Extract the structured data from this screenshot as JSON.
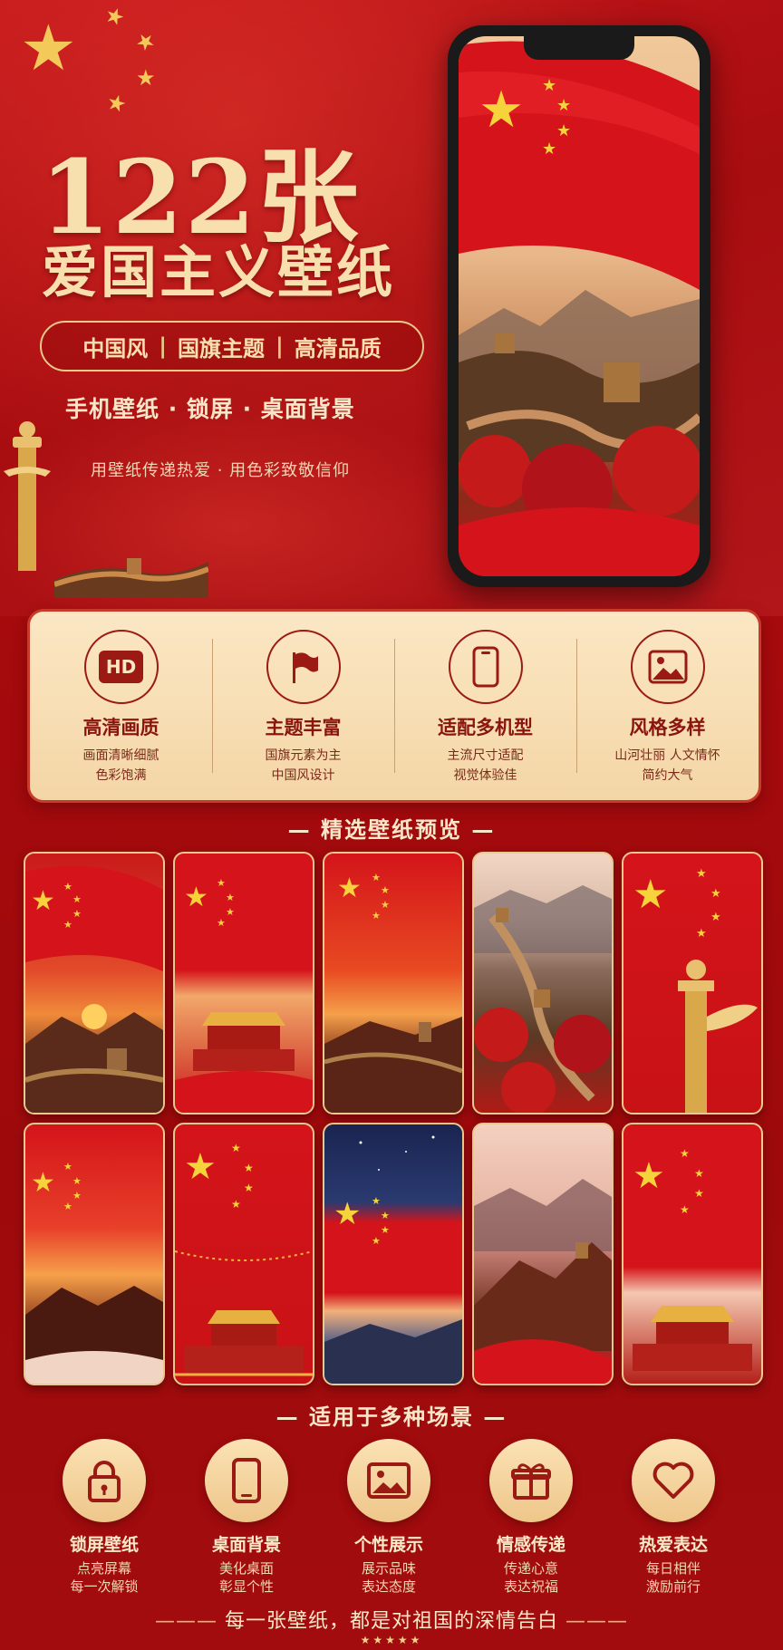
{
  "hero": {
    "title_number": "122张",
    "title_text": "爱国主义壁纸",
    "tags": [
      "中国风",
      "国旗主题",
      "高清品质"
    ],
    "tag_separator": "|",
    "usage_line": "手机壁纸 · 锁屏 · 桌面背景",
    "slogan": "用壁纸传递热爱 · 用色彩致敬信仰"
  },
  "features": [
    {
      "icon": "hd-icon",
      "badge": "HD",
      "title": "高清画质",
      "desc1": "画面清晰细腻",
      "desc2": "色彩饱满"
    },
    {
      "icon": "flag-icon",
      "badge": "",
      "title": "主题丰富",
      "desc1": "国旗元素为主",
      "desc2": "中国风设计"
    },
    {
      "icon": "phone-icon",
      "badge": "",
      "title": "适配多机型",
      "desc1": "主流尺寸适配",
      "desc2": "视觉体验佳"
    },
    {
      "icon": "image-icon",
      "badge": "",
      "title": "风格多样",
      "desc1": "山河壮丽 人文情怀",
      "desc2": "简约大气"
    }
  ],
  "preview_title": "— 精选壁纸预览 —",
  "scenes_title": "— 适用于多种场景 —",
  "scenes": [
    {
      "icon": "lock-icon",
      "title": "锁屏壁纸",
      "desc1": "点亮屏幕",
      "desc2": "每一次解锁"
    },
    {
      "icon": "phone-icon",
      "title": "桌面背景",
      "desc1": "美化桌面",
      "desc2": "彰显个性"
    },
    {
      "icon": "image-icon",
      "title": "个性展示",
      "desc1": "展示品味",
      "desc2": "表达态度"
    },
    {
      "icon": "gift-icon",
      "title": "情感传递",
      "desc1": "传递心意",
      "desc2": "表达祝福"
    },
    {
      "icon": "heart-icon",
      "title": "热爱表达",
      "desc1": "每日相伴",
      "desc2": "激励前行"
    }
  ],
  "footer": {
    "text": "每一张壁纸，都是对祖国的深情告白",
    "stars": "★★★★★"
  },
  "colors": {
    "flag_red": "#d4141a",
    "gold": "#f3c95a",
    "cream": "#fbe7c4",
    "dark_red": "#8a140f"
  }
}
